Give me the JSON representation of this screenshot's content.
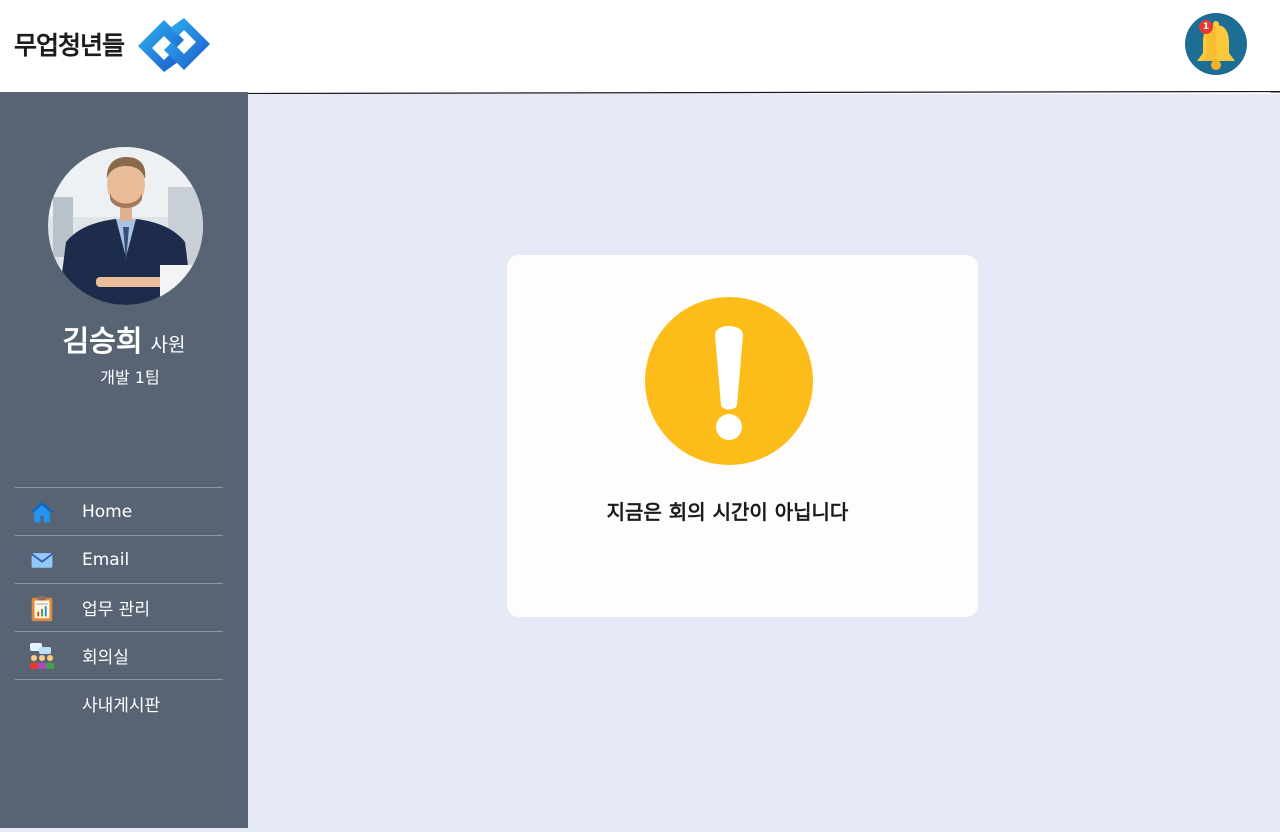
{
  "header": {
    "logo_text": "무업청년들",
    "notification_count": "1"
  },
  "sidebar": {
    "user_name": "김승희",
    "user_rank": "사원",
    "user_team": "개발 1팀",
    "items": [
      {
        "label": "Home",
        "icon": "home-icon"
      },
      {
        "label": "Email",
        "icon": "mail-icon"
      },
      {
        "label": "업무 관리",
        "icon": "clipboard-icon"
      },
      {
        "label": "회의실",
        "icon": "meeting-icon"
      },
      {
        "label": "사내게시판",
        "icon": ""
      }
    ]
  },
  "main": {
    "message": "지금은 회의 시간이 아닙니다"
  },
  "colors": {
    "sidebar_bg": "#586474",
    "main_bg": "#e6e9f6",
    "warning": "#fcbc19",
    "bell_bg": "#1c6e95"
  }
}
